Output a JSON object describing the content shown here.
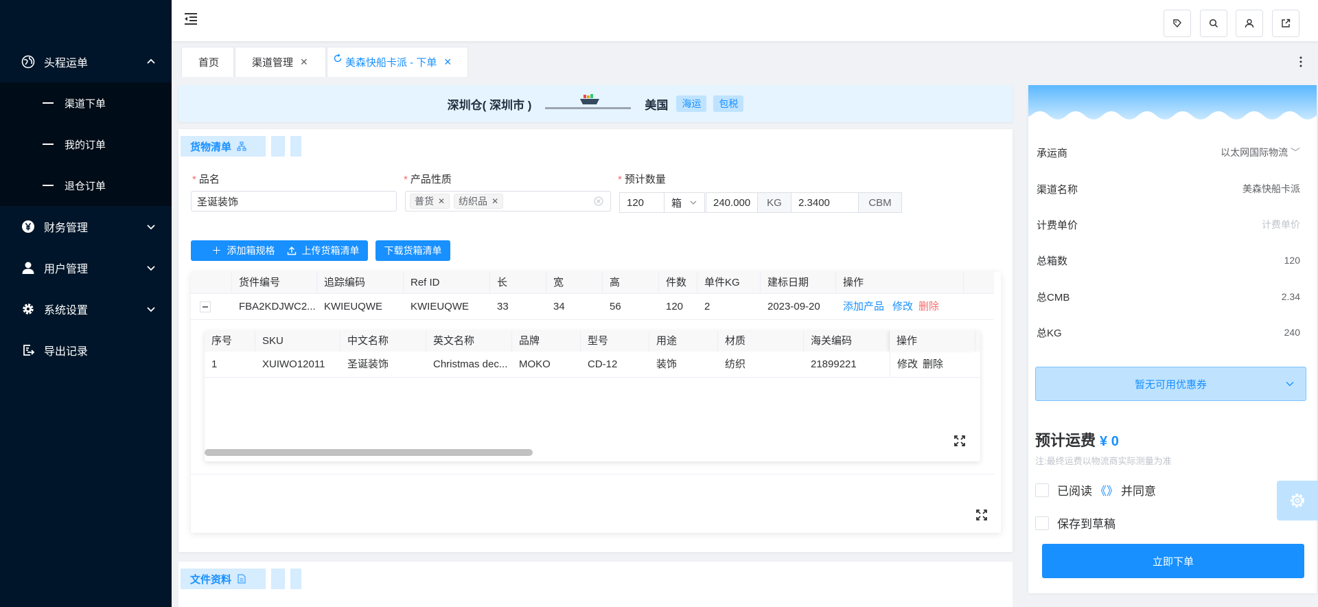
{
  "sidebar": {
    "items": [
      {
        "label": "头程运单",
        "icon": "globe-icon",
        "expanded": true
      },
      {
        "label": "财务管理",
        "icon": "yen-icon"
      },
      {
        "label": "用户管理",
        "icon": "user-icon"
      },
      {
        "label": "系统设置",
        "icon": "gear-icon"
      },
      {
        "label": "导出记录",
        "icon": "export-icon"
      }
    ],
    "sub_items": [
      {
        "label": "渠道下单"
      },
      {
        "label": "我的订单"
      },
      {
        "label": "退仓订单"
      }
    ]
  },
  "tabs": [
    {
      "label": "首页"
    },
    {
      "label": "渠道管理"
    },
    {
      "label": "美森快船卡派 - 下单"
    }
  ],
  "route": {
    "from": "深圳仓( 深圳市 )",
    "to": "美国",
    "tags": [
      "海运",
      "包税"
    ]
  },
  "cargo": {
    "section_title": "货物清单",
    "name_label": "品名",
    "name_value": "圣诞装饰",
    "nature_label": "产品性质",
    "nature_chips": [
      "普货",
      "纺织品"
    ],
    "qty_label": "预计数量",
    "qty_value": "120",
    "qty_unit": "箱",
    "weight_value": "240.000",
    "weight_unit": "KG",
    "volume_value": "2.3400",
    "volume_unit": "CBM",
    "buttons": {
      "add": "添加箱规格",
      "upload": "上传货箱清单",
      "download": "下载货箱清单"
    }
  },
  "outer_table": {
    "headers": [
      "货件编号",
      "追踪编码",
      "Ref ID",
      "长",
      "宽",
      "高",
      "件数",
      "单件KG",
      "建标日期",
      "操作"
    ],
    "row": {
      "shipment": "FBA2KDJWC2...",
      "tracking": "KWIEUQWE",
      "ref": "KWIEUQWE",
      "l": "33",
      "w": "34",
      "h": "56",
      "count": "120",
      "kg": "2",
      "date": "2023-09-20",
      "act_add": "添加产品",
      "act_edit": "修改",
      "act_del": "删除"
    }
  },
  "inner_table": {
    "headers": [
      "序号",
      "SKU",
      "中文名称",
      "英文名称",
      "品牌",
      "型号",
      "用途",
      "材质",
      "海关编码",
      "操作"
    ],
    "row": {
      "idx": "1",
      "sku": "XUIWO12011",
      "cn": "圣诞装饰",
      "en": "Christmas dec...",
      "brand": "MOKO",
      "model": "CD-12",
      "usage": "装饰",
      "material": "纺织",
      "hs": "21899221",
      "act_edit": "修改",
      "act_del": "删除"
    }
  },
  "docs": {
    "section_title": "文件资料"
  },
  "right": {
    "carrier_label": "承运商",
    "carrier_value": "以太网国际物流",
    "channel_label": "渠道名称",
    "channel_value": "美森快船卡派",
    "unit_label": "计费单价",
    "unit_placeholder": "计费单价",
    "boxes_label": "总箱数",
    "boxes_value": "120",
    "cmb_label": "总CMB",
    "cmb_value": "2.34",
    "kg_label": "总KG",
    "kg_value": "240",
    "coupon": "暂无可用优惠券",
    "est_label": "预计运费",
    "est_value": "¥ 0",
    "note": "注:最终运费以物流商实际测量为准",
    "agree_pre": "已阅读",
    "agree_link": "《》",
    "agree_post": "并同意",
    "draft": "保存到草稿",
    "submit": "立即下单"
  },
  "colors": {
    "primary": "#1890ff",
    "sidebar": "#001529",
    "danger": "#f56c6c"
  }
}
